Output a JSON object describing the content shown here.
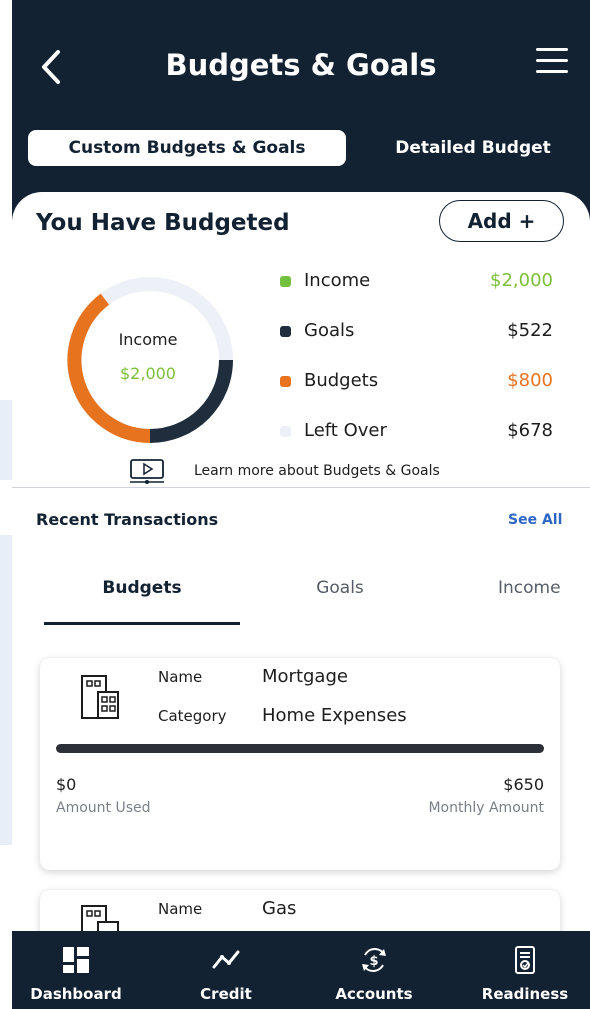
{
  "header": {
    "title": "Budgets & Goals",
    "segments": {
      "active": "Custom Budgets & Goals",
      "inactive": "Detailed Budget"
    }
  },
  "summary": {
    "title": "You Have Budgeted",
    "add_label": "Add +",
    "donut": {
      "label": "Income",
      "value": "$2,000"
    },
    "legend": [
      {
        "label": "Income",
        "value": "$2,000",
        "color": "#72c03e"
      },
      {
        "label": "Goals",
        "value": "$522",
        "color": "#1f2d3d"
      },
      {
        "label": "Budgets",
        "value": "$800",
        "color": "#e8731f"
      },
      {
        "label": "Left Over",
        "value": "$678",
        "color": "#eef0f7"
      }
    ],
    "learn_more": "Learn more about Budgets & Goals"
  },
  "recent": {
    "title": "Recent Transactions",
    "see_all": "See All",
    "tabs": [
      "Budgets",
      "Goals",
      "Income"
    ],
    "transactions": [
      {
        "name_key": "Name",
        "name": "Mortgage",
        "category_key": "Category",
        "category": "Home Expenses",
        "used": "$0",
        "used_label": "Amount Used",
        "monthly": "$650",
        "monthly_label": "Monthly Amount",
        "progress": 0
      },
      {
        "name_key": "Name",
        "name": "Gas"
      }
    ]
  },
  "nav": {
    "items": [
      "Dashboard",
      "Credit",
      "Accounts",
      "Readiness"
    ]
  }
}
